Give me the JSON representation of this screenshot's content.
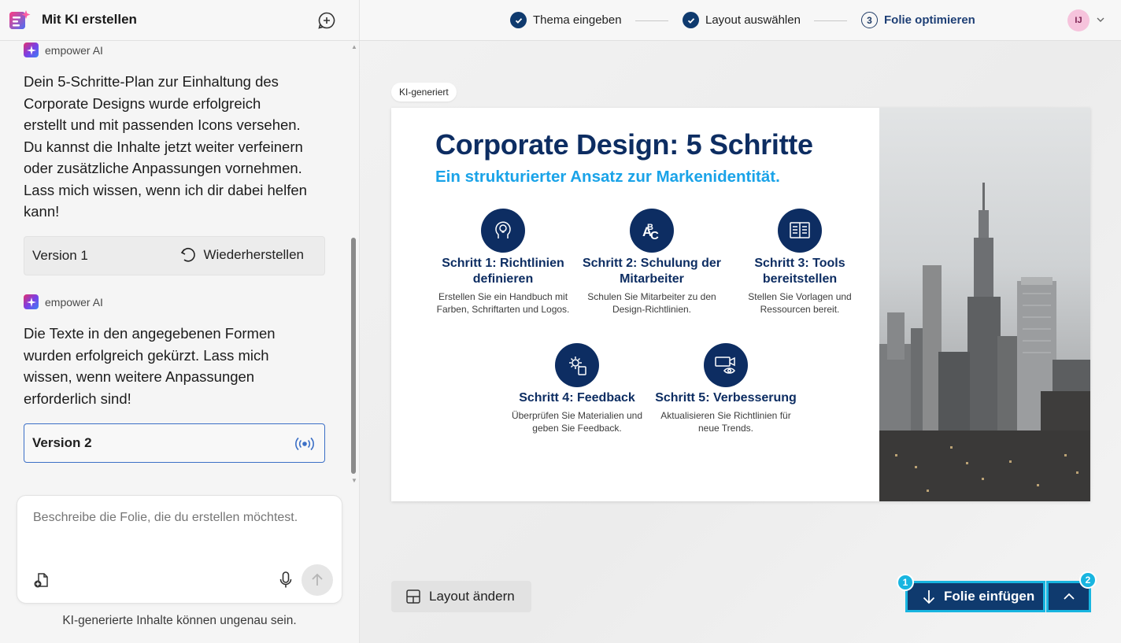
{
  "left_panel": {
    "title": "Mit KI erstellen",
    "messages": [
      {
        "sender": "empower AI",
        "text": "Dein 5-Schritte-Plan zur Einhaltung des Corporate Designs wurde erfolgreich erstellt und mit passenden Icons versehen. Du kannst die Inhalte jetzt weiter verfeinern oder zusätzliche Anpassungen vornehmen. Lass mich wissen, wenn ich dir dabei helfen kann!",
        "version_label": "Version 1",
        "version_action": "Wiederherstellen"
      },
      {
        "sender": "empower AI",
        "text": "Die Texte in den angegebenen Formen wurden erfolgreich gekürzt. Lass mich wissen, wenn weitere Anpassungen erforderlich sind!",
        "version_label": "Version 2"
      }
    ],
    "input_placeholder": "Beschreibe die Folie, die du erstellen möchtest.",
    "disclaimer": "KI-generierte Inhalte können ungenau sein."
  },
  "steps": [
    {
      "label": "Thema eingeben",
      "state": "done"
    },
    {
      "label": "Layout auswählen",
      "state": "done"
    },
    {
      "number": "3",
      "label": "Folie optimieren",
      "state": "active"
    }
  ],
  "user": {
    "initials": "IJ"
  },
  "badge": "KI-generiert",
  "slide": {
    "title": "Corporate Design: 5 Schritte",
    "subtitle": "Ein strukturierter Ansatz zur Markenidentität.",
    "items": [
      {
        "icon": "lightbulb-head-icon",
        "head": "Schritt 1: Richtlinien definieren",
        "desc": "Erstellen Sie ein Handbuch mit Farben, Schriftarten und Logos."
      },
      {
        "icon": "abc-training-icon",
        "head": "Schritt 2: Schulung der Mitarbeiter",
        "desc": "Schulen Sie Mitarbeiter zu den Design-Richtlinien."
      },
      {
        "icon": "open-book-icon",
        "head": "Schritt 3: Tools bereitstellen",
        "desc": "Stellen Sie Vorlagen und Ressourcen bereit."
      },
      {
        "icon": "gear-document-icon",
        "head": "Schritt 4: Feedback",
        "desc": "Überprüfen Sie Materialien und geben Sie Feedback."
      },
      {
        "icon": "monitor-eye-icon",
        "head": "Schritt 5: Verbesserung",
        "desc": "Aktualisieren Sie Richtlinien für neue Trends."
      }
    ]
  },
  "actions": {
    "layout": "Layout ändern",
    "insert": "Folie einfügen",
    "badge_1": "1",
    "badge_2": "2"
  },
  "colors": {
    "navy": "#0d2d62",
    "accent": "#1aa3e8",
    "highlight": "#18b5e0"
  }
}
